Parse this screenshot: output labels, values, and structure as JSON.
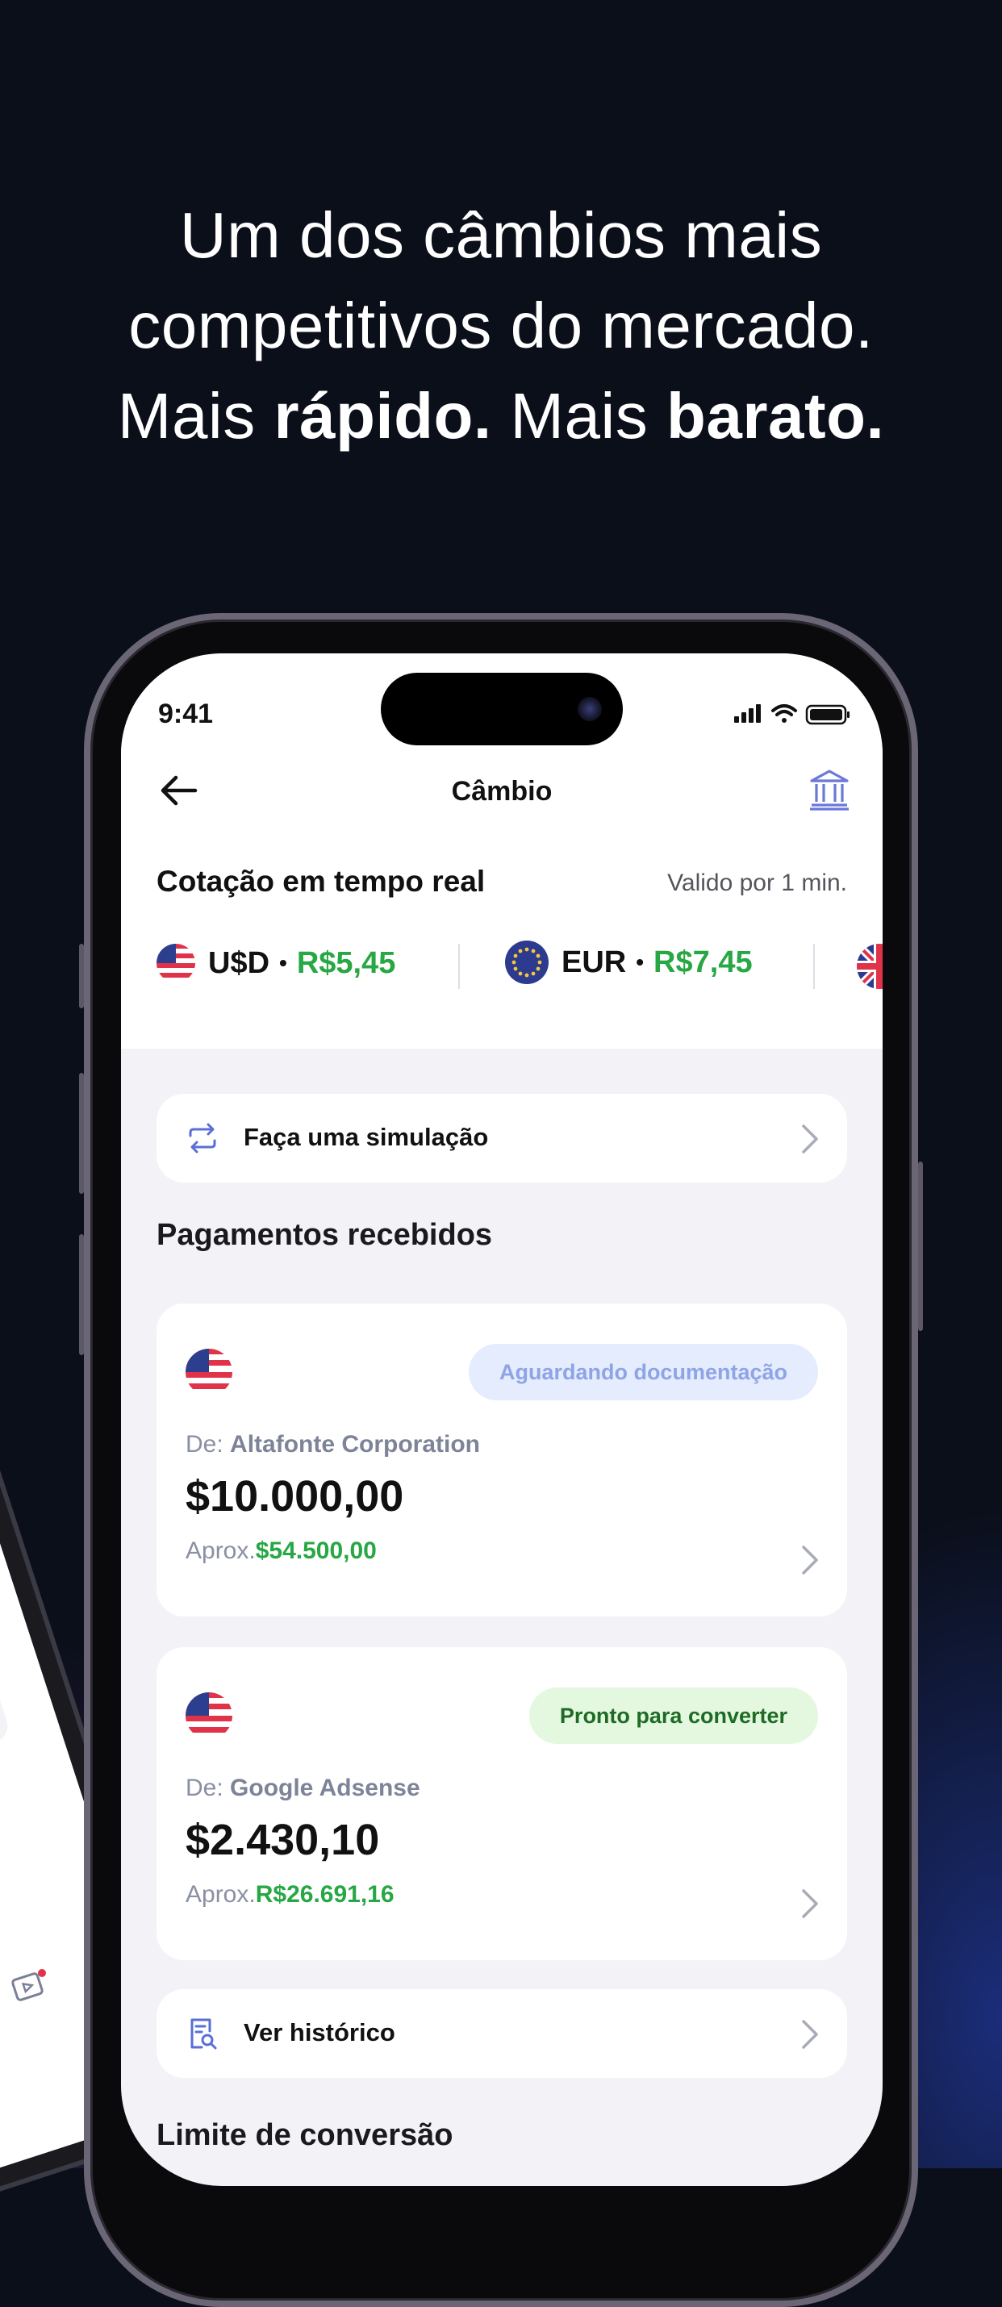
{
  "headline": {
    "line1": "Um dos câmbios mais",
    "line2": "competitivos do mercado.",
    "line3_a": "Mais ",
    "line3_b": "rápido.",
    "line3_c": " Mais ",
    "line3_d": "barato."
  },
  "status_bar": {
    "time": "9:41"
  },
  "nav": {
    "title": "Câmbio",
    "back_icon": "arrow-left-icon",
    "right_icon": "bank-icon"
  },
  "quote": {
    "title": "Cotação em tempo real",
    "validity": "Valido por 1 min.",
    "rates": [
      {
        "currency": "U$D",
        "separator": "•",
        "value": "R$5,45",
        "flag": "us-flag-icon"
      },
      {
        "currency": "EUR",
        "separator": "•",
        "value": "R$7,45",
        "flag": "eu-flag-icon"
      },
      {
        "flag": "uk-flag-icon"
      }
    ]
  },
  "simulation": {
    "label": "Faça uma simulação",
    "icon": "repeat-icon"
  },
  "payments": {
    "title": "Pagamentos recebidos",
    "items": [
      {
        "badge": "Aguardando documentação",
        "from_prefix": "De: ",
        "from_name": "Altafonte Corporation",
        "amount": "$10.000,00",
        "approx_prefix": "Aprox.",
        "approx_value": "$54.500,00",
        "flag": "us-flag-icon"
      },
      {
        "badge": "Pronto para converter",
        "from_prefix": "De: ",
        "from_name": "Google Adsense",
        "amount": "$2.430,10",
        "approx_prefix": "Aprox.",
        "approx_value": "R$26.691,16",
        "flag": "us-flag-icon"
      }
    ]
  },
  "history": {
    "label": "Ver histórico",
    "icon": "receipt-search-icon"
  },
  "limit": {
    "title": "Limite de conversão"
  },
  "colors": {
    "accent_green": "#28a745",
    "accent_blue": "#5a6fd6",
    "background": "#0b0f1a"
  }
}
